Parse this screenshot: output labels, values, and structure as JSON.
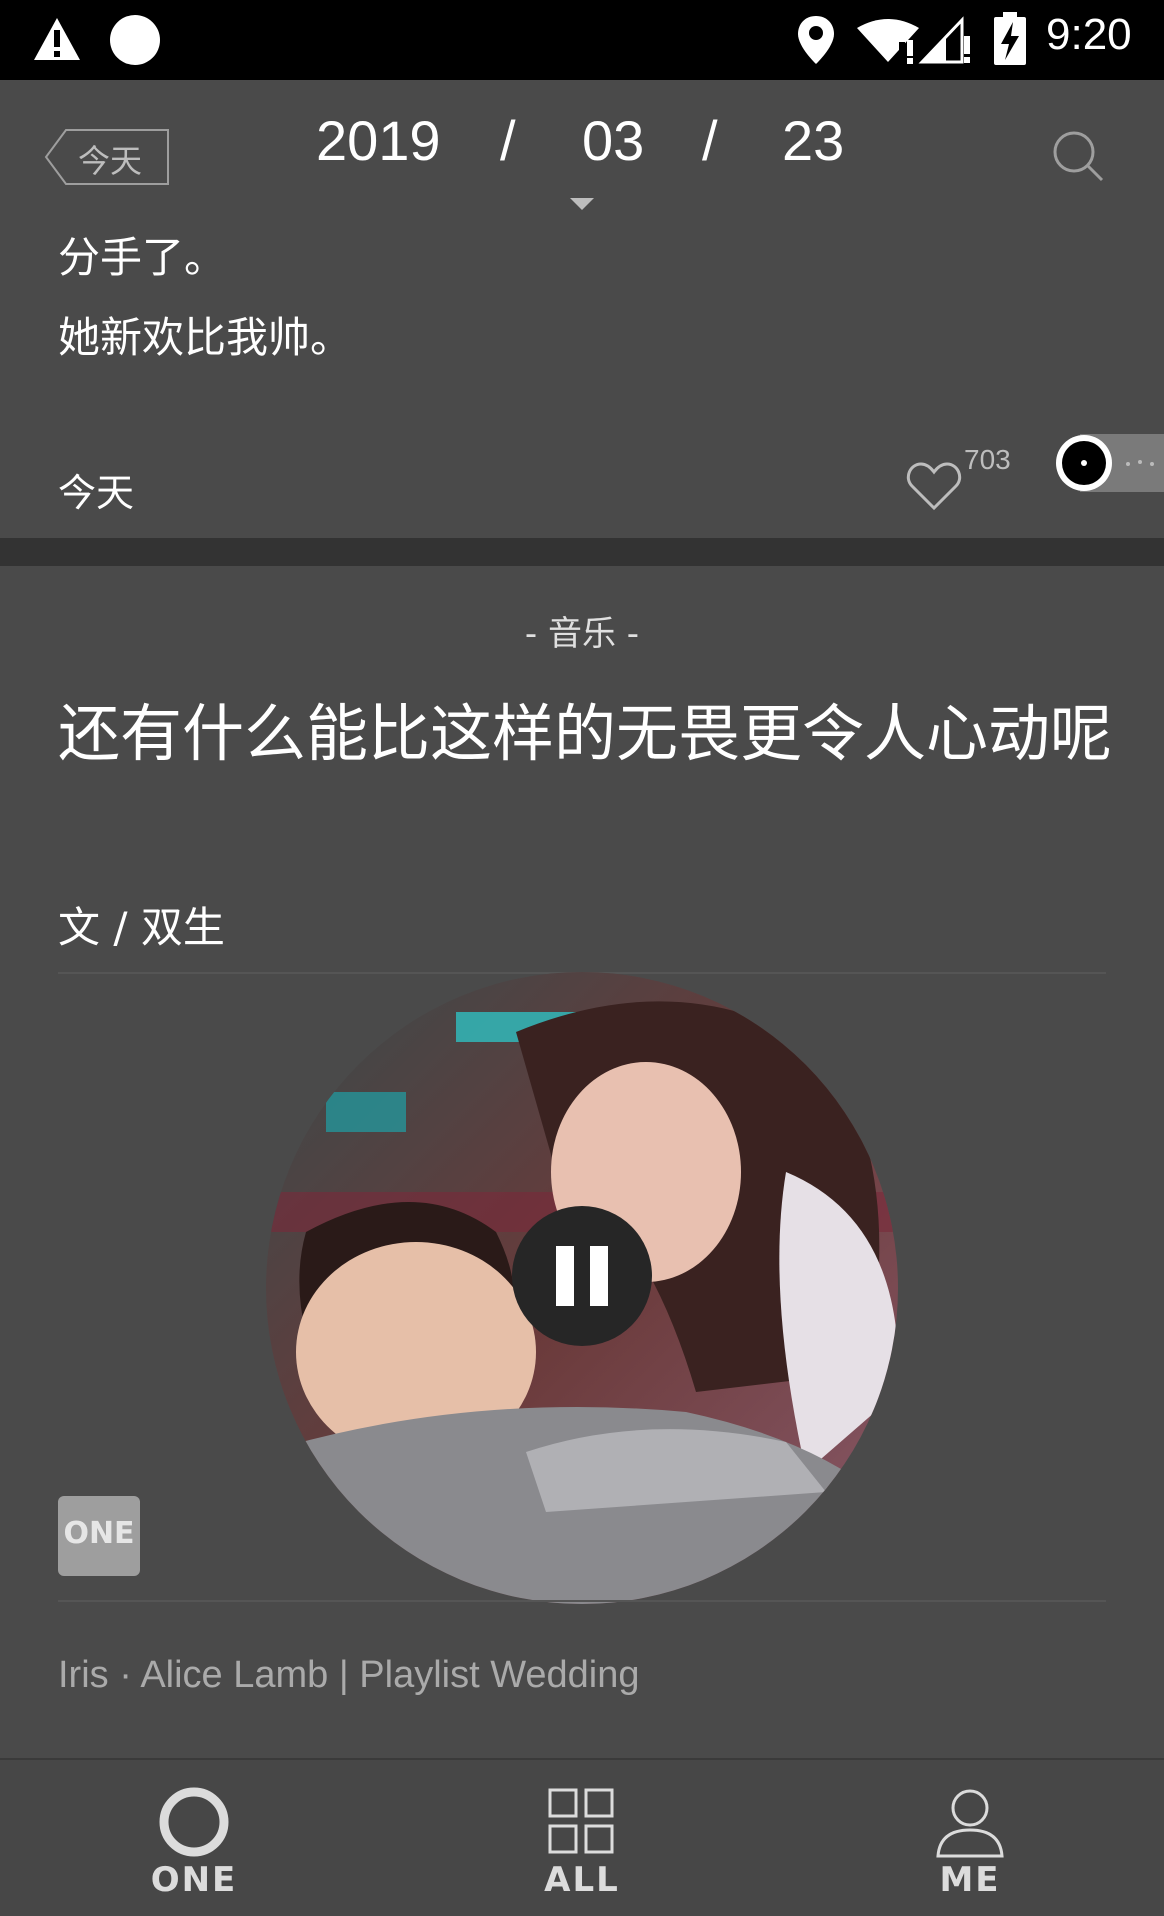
{
  "status_bar": {
    "time": "9:20",
    "icons": [
      "warning-icon",
      "circle-notification-icon",
      "location-icon",
      "wifi-icon",
      "cell-signal-icon",
      "battery-charging-icon"
    ]
  },
  "header": {
    "today_label": "今天",
    "date": {
      "year": "2019",
      "sep1": "/",
      "month": "03",
      "sep2": "/",
      "day": "23"
    },
    "search_icon": "search-icon"
  },
  "top_card": {
    "line1": "分手了。",
    "line2": "她新欢比我帅。",
    "footer_label": "今天",
    "likes": "703"
  },
  "music": {
    "category": "- 音乐 -",
    "title": "还有什么能比这样的无畏更令人心动呢",
    "author": "文 / 双生",
    "badge": "ONE",
    "song": "Iris · Alice Lamb | Playlist Wedding"
  },
  "bottom_nav": {
    "items": [
      {
        "label": "ONE",
        "icon": "circle-icon"
      },
      {
        "label": "ALL",
        "icon": "grid-icon"
      },
      {
        "label": "ME",
        "icon": "user-icon"
      }
    ]
  },
  "colors": {
    "background": "#4a4a4a",
    "separator": "#333333",
    "status_bar": "#000000"
  }
}
